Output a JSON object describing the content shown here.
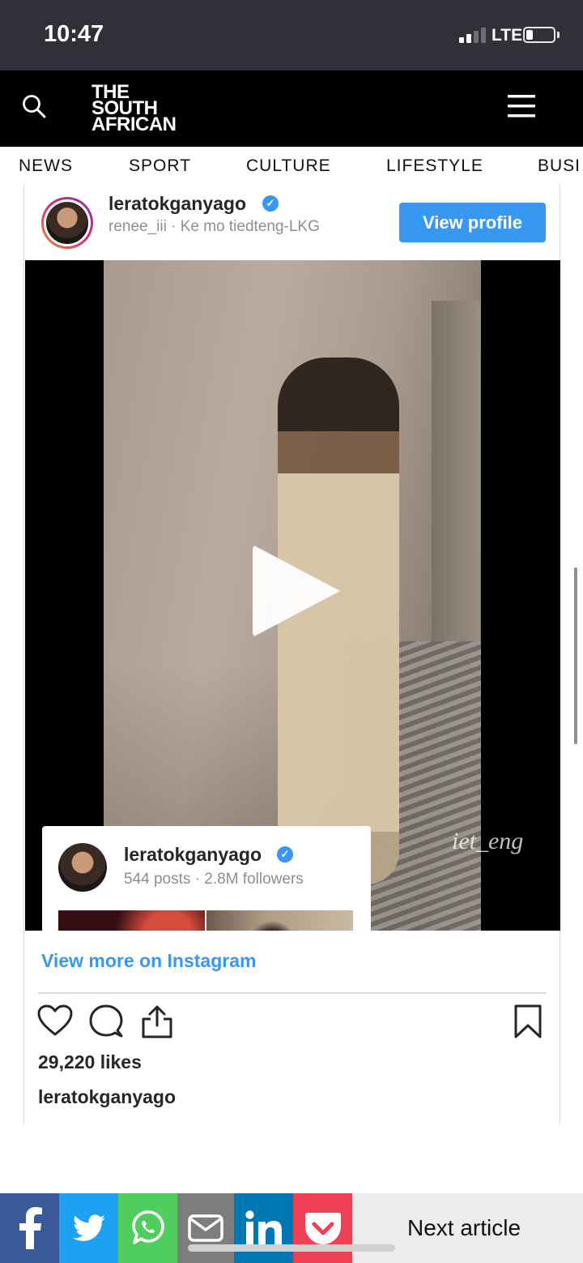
{
  "status_bar": {
    "time": "10:47",
    "network": "LTE"
  },
  "header": {
    "logo_lines": [
      "THE",
      "SOUTH",
      "AFRICAN"
    ]
  },
  "nav": {
    "items": [
      "NEWS",
      "SPORT",
      "CULTURE",
      "LIFESTYLE",
      "BUSI"
    ]
  },
  "instagram_embed": {
    "username": "leratokganyago",
    "subtitle": "renee_iii · Ke mo tiedteng-LKG",
    "view_profile_label": "View profile",
    "video_watermark": "iet_eng",
    "hover_card": {
      "username": "leratokganyago",
      "stats": "544 posts · 2.8M followers"
    },
    "view_more_label": "View more on Instagram",
    "likes": "29,220 likes",
    "owner": "leratokganyago"
  },
  "share_bar": {
    "colors": {
      "facebook": "#3b5998",
      "twitter": "#1da1f2",
      "whatsapp": "#4fce5d",
      "email": "#7d7d7d",
      "linkedin": "#0077b5",
      "pocket": "#ef4056"
    },
    "next_article_label": "Next article"
  },
  "colors": {
    "status_bar_bg": "#303038",
    "header_bg": "#000000",
    "instagram_blue": "#3897f0"
  }
}
